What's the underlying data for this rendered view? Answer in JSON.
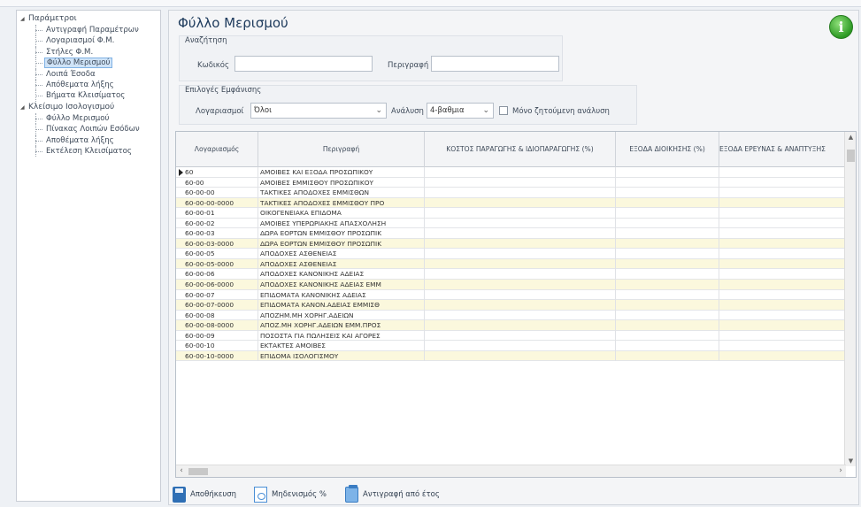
{
  "sidebar": {
    "groups": [
      {
        "label": "Παράμετροι",
        "items": [
          {
            "label": "Αντιγραφή Παραμέτρων"
          },
          {
            "label": "Λογαριασμοί Φ.Μ."
          },
          {
            "label": "Στήλες Φ.Μ."
          },
          {
            "label": "Φύλλο Μερισμού",
            "selected": true
          },
          {
            "label": "Λοιπά Έσοδα"
          },
          {
            "label": "Απόθεματα λήξης"
          },
          {
            "label": "Βήματα Κλεισίματος"
          }
        ]
      },
      {
        "label": "Κλείσιμο Ισολογισμού",
        "items": [
          {
            "label": "Φύλλο Μερισμού"
          },
          {
            "label": "Πίνακας Λοιπών Εσόδων"
          },
          {
            "label": "Αποθέματα λήξης"
          },
          {
            "label": "Εκτέλεση Κλεισίματος"
          }
        ]
      }
    ]
  },
  "main": {
    "title": "Φύλλο Μερισμού",
    "info_icon": "i",
    "search": {
      "title": "Αναζήτηση",
      "code_label": "Κωδικός",
      "code_value": "",
      "desc_label": "Περιγραφή",
      "desc_value": ""
    },
    "display": {
      "title": "Επιλογές Εμφάνισης",
      "accounts_label": "Λογαριασμοί",
      "accounts_value": "Όλοι",
      "analysis_label": "Ανάλυση",
      "analysis_value": "4-βαθμια",
      "only_requested_label": "Μόνο ζητούμενη ανάλυση",
      "only_requested_checked": false
    }
  },
  "grid": {
    "columns": [
      "Λογαριασμός",
      "Περιγραφή",
      "ΚΟΣΤΟΣ ΠΑΡΑΓΩΓΗΣ & ΙΔΙΟΠΑΡΑΓΩΓΗΣ (%)",
      "ΕΞΟΔΑ ΔΙΟΙΚΗΣΗΣ (%)",
      "ΕΞΟΔΑ ΕΡΕΥΝΑΣ & ΑΝΑΠΤΥΞΗΣ"
    ],
    "rows": [
      {
        "code": "60",
        "desc": "ΑΜΟΙΒΕΣ ΚΑΙ ΕΞΟΔΑ ΠΡΟΣΩΠΙΚΟΥ",
        "current": true
      },
      {
        "code": "60-00",
        "desc": "ΑΜΟΙΒΕΣ ΕΜΜΙΣΘΟΥ ΠΡΟΣΩΠΙΚΟΥ"
      },
      {
        "code": "60-00-00",
        "desc": "ΤΑΚΤΙΚΕΣ ΑΠΟΔΟΧΕΣ ΕΜΜΙΣΘΩΝ"
      },
      {
        "code": "60-00-00-0000",
        "desc": "ΤΑΚΤΙΚΕΣ ΑΠΟΔΟΧΕΣ ΕΜΜΙΣΘΟΥ ΠΡΟ",
        "leaf": true
      },
      {
        "code": "60-00-01",
        "desc": "ΟΙΚΟΓΕΝΕΙΑΚΑ ΕΠΙΔΟΜΑ"
      },
      {
        "code": "60-00-02",
        "desc": "ΑΜΟΙΒΕΣ ΥΠΕΡΩΡΙΑΚΗΣ ΑΠΑΣΧΟΛΗΣΗ"
      },
      {
        "code": "60-00-03",
        "desc": "ΔΩΡΑ ΕΟΡΤΩΝ ΕΜΜΙΣΘΟΥ ΠΡΟΣΩΠΙΚ"
      },
      {
        "code": "60-00-03-0000",
        "desc": "ΔΩΡΑ ΕΟΡΤΩΝ ΕΜΜΙΣΘΟΥ ΠΡΟΣΩΠΙΚ",
        "leaf": true
      },
      {
        "code": "60-00-05",
        "desc": "ΑΠΟΔΟΧΕΣ ΑΣΘΕΝΕΙΑΣ"
      },
      {
        "code": "60-00-05-0000",
        "desc": "ΑΠΟΔΟΧΕΣ ΑΣΘΕΝΕΙΑΣ",
        "leaf": true
      },
      {
        "code": "60-00-06",
        "desc": "ΑΠΟΔΟΧΕΣ ΚΑΝΟΝΙΚΗΣ ΑΔΕΙΑΣ"
      },
      {
        "code": "60-00-06-0000",
        "desc": "ΑΠΟΔΟΧΕΣ ΚΑΝΟΝΙΚΗΣ ΑΔΕΙΑΣ ΕΜΜ",
        "leaf": true
      },
      {
        "code": "60-00-07",
        "desc": "ΕΠΙΔΟΜΑΤΑ ΚΑΝΟΝΙΚΗΣ ΑΔΕΙΑΣ"
      },
      {
        "code": "60-00-07-0000",
        "desc": "ΕΠΙΔΟΜΑΤΑ ΚΑΝΟΝ.ΑΔΕΙΑΣ ΕΜΜΙΣΘ",
        "leaf": true
      },
      {
        "code": "60-00-08",
        "desc": "ΑΠΟΖΗΜ.ΜΗ ΧΟΡΗΓ.ΑΔΕΙΩΝ"
      },
      {
        "code": "60-00-08-0000",
        "desc": "ΑΠΟΖ.ΜΗ ΧΟΡΗΓ.ΑΔΕΙΩΝ ΕΜΜ.ΠΡΟΣ",
        "leaf": true
      },
      {
        "code": "60-00-09",
        "desc": "ΠΟΣΟΣΤΑ ΓΙΑ ΠΩΛΗΣΕΙΣ ΚΑΙ ΑΓΟΡΕΣ"
      },
      {
        "code": "60-00-10",
        "desc": "ΕΚΤΑΚΤΕΣ ΑΜΟΙΒΕΣ"
      },
      {
        "code": "60-00-10-0000",
        "desc": "ΕΠΙΔΟΜΑ ΙΣΟΛΟΓΙΣΜΟΥ",
        "leaf": true
      }
    ]
  },
  "toolbar": {
    "save_label": "Αποθήκευση",
    "zero_label": "Μηδενισμός %",
    "copy_label": "Αντιγραφή από έτος"
  },
  "colors": {
    "leaf_row": "#fbf8dd",
    "title": "#1d3a5c",
    "info_green": "#2e9a25"
  }
}
